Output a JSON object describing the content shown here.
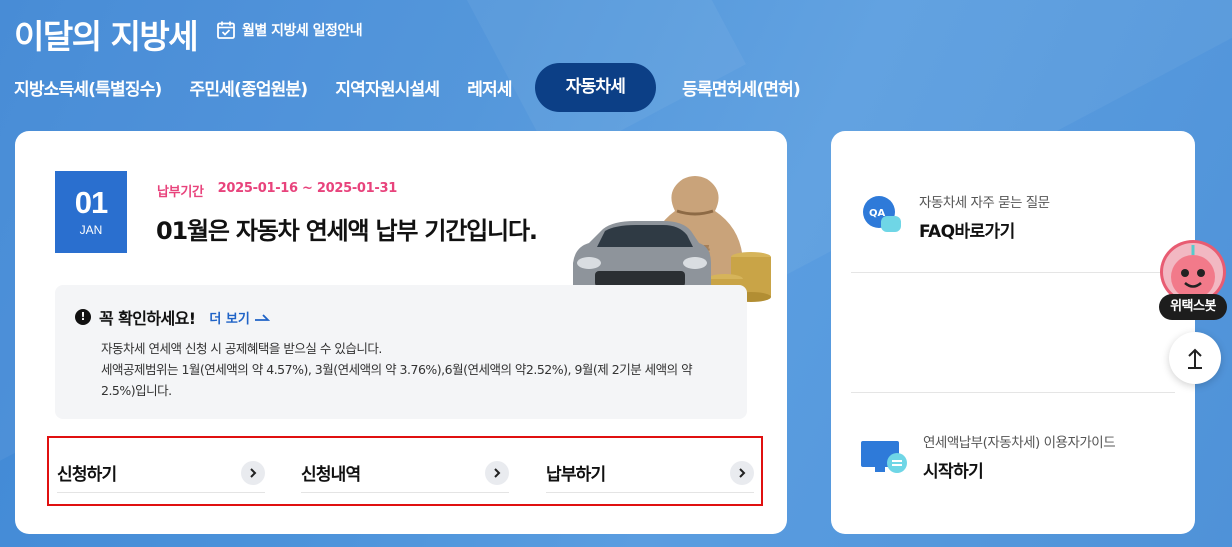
{
  "header": {
    "title": "이달의 지방세",
    "schedule_link": "월별 지방세 일정안내"
  },
  "tabs": [
    {
      "label": "지방소득세(특별징수)",
      "active": false
    },
    {
      "label": "주민세(종업원분)",
      "active": false
    },
    {
      "label": "지역자원시설세",
      "active": false
    },
    {
      "label": "레저세",
      "active": false
    },
    {
      "label": "자동차세",
      "active": true
    },
    {
      "label": "등록면허세(면허)",
      "active": false
    }
  ],
  "main": {
    "date_num": "01",
    "date_month": "JAN",
    "period_label": "납부기간",
    "period_range": "2025-01-16 ~ 2025-01-31",
    "headline": "01월은 자동차 연세액 납부 기간입니다.",
    "notice": {
      "title": "꼭 확인하세요!",
      "more": "더 보기",
      "line1": "자동차세 연세액 신청 시 공제혜택을 받으실 수 있습니다.",
      "line2": "세액공제범위는 1월(연세액의 약 4.57%), 3월(연세액의 약 3.76%),6월(연세액의 약2.52%), 9월(제 2기분 세액의 약 2.5%)입니다."
    },
    "actions": [
      {
        "label": "신청하기"
      },
      {
        "label": "신청내역"
      },
      {
        "label": "납부하기"
      }
    ]
  },
  "side": {
    "faq_sub": "자동차세 자주 묻는 질문",
    "faq_main": "FAQ바로가기",
    "guide_sub": "연세액납부(자동차세) 이용자가이드",
    "guide_main": "시작하기"
  },
  "floating": {
    "bot_label": "위택스봇"
  },
  "colors": {
    "background": "#4b92da",
    "active_tab": "#0c3f86",
    "date_box": "#2a6fcf",
    "period": "#e8437c",
    "highlight_border": "#e01010"
  }
}
